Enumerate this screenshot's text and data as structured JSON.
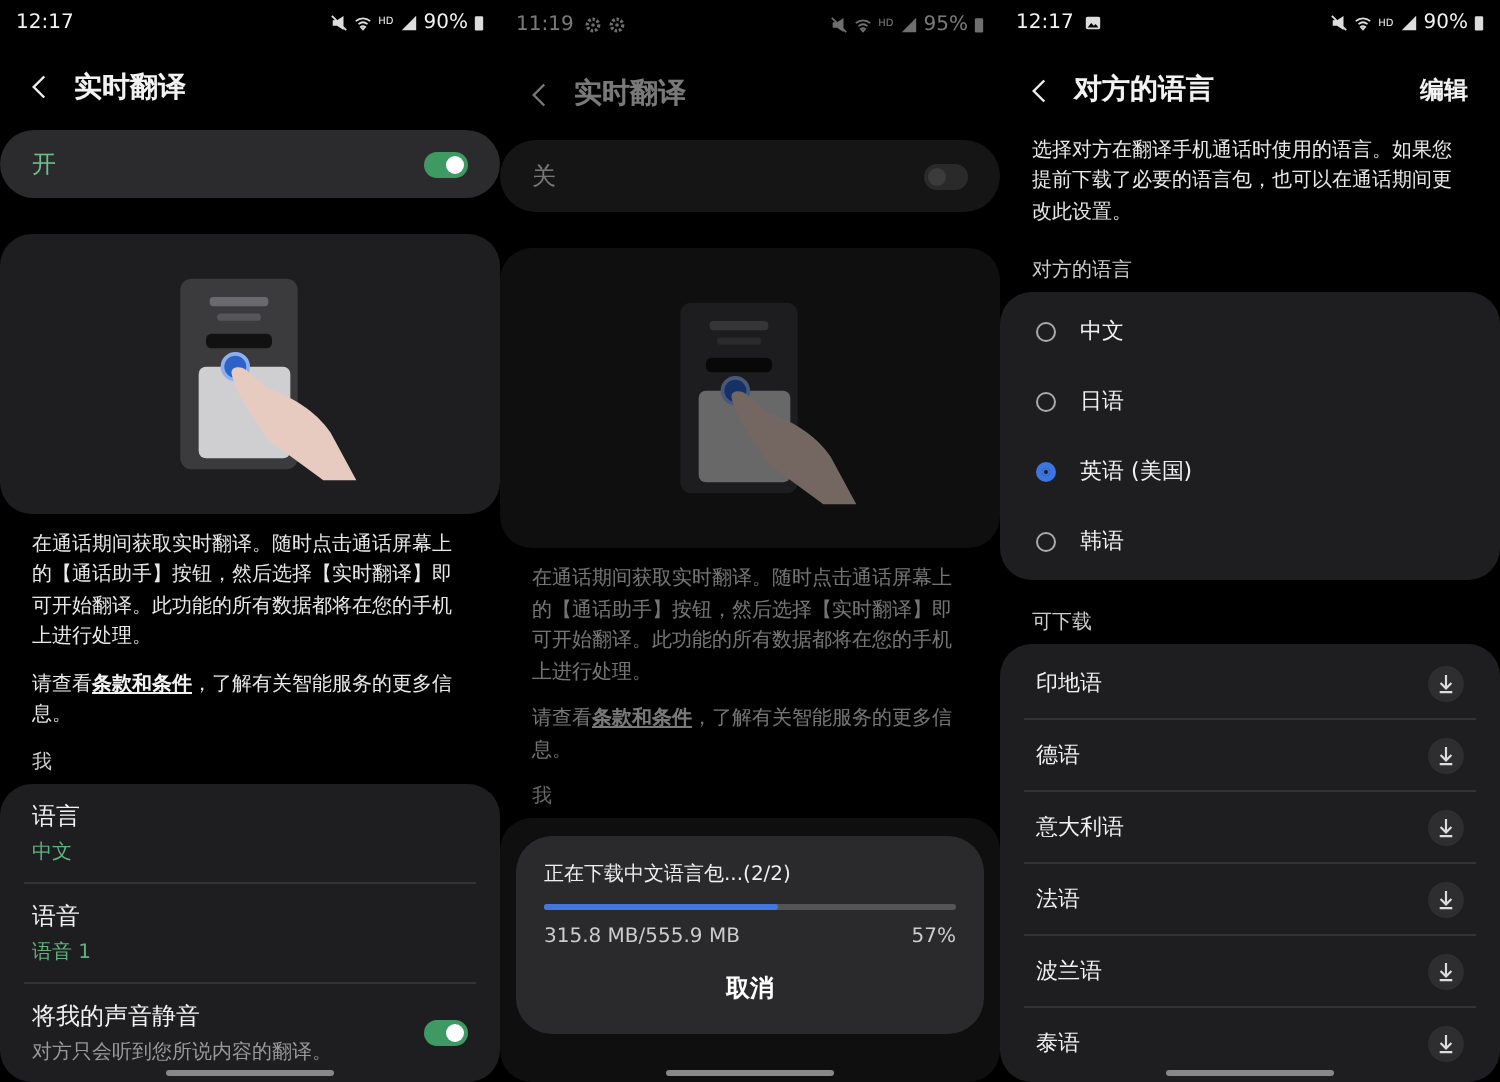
{
  "screens": [
    {
      "kind": "settings",
      "dimmed": false,
      "status_bar": {
        "time": "12:17",
        "network": "HD",
        "battery": "90%"
      },
      "title": "实时翻译",
      "master_switch": {
        "label": "开",
        "on": true
      },
      "description": "在通话期间获取实时翻译。随时点击通话屏幕上的【通话助手】按钮，然后选择【实时翻译】即可开始翻译。此功能的所有数据都将在您的手机上进行处理。",
      "terms": {
        "before": "请查看",
        "link": "条款和条件",
        "after": "，了解有关智能服务的更多信息。"
      },
      "section_label": "我",
      "settings": [
        {
          "kind": "value",
          "title": "语言",
          "value": "中文"
        },
        {
          "kind": "value",
          "title": "语音",
          "value": "语音 1"
        },
        {
          "kind": "switch",
          "title": "将我的声音静音",
          "subtitle": "对方只会听到您所说内容的翻译。",
          "on": true
        }
      ]
    },
    {
      "kind": "settings",
      "dimmed": true,
      "status_bar": {
        "time": "11:19",
        "icons": [
          {
            "kind": "gear"
          },
          {
            "kind": "gear"
          }
        ],
        "network": "HD",
        "battery": "95%"
      },
      "title": "实时翻译",
      "master_switch": {
        "label": "关",
        "on": false
      },
      "description": "在通话期间获取实时翻译。随时点击通话屏幕上的【通话助手】按钮，然后选择【实时翻译】即可开始翻译。此功能的所有数据都将在您的手机上进行处理。",
      "terms": {
        "before": "请查看",
        "link": "条款和条件",
        "after": "，了解有关智能服务的更多信息。"
      },
      "section_label": "我",
      "dialog": {
        "title": "正在下载中文语言包...(2/2)",
        "level": 0.57,
        "size": "315.8 MB/555.9 MB",
        "percent": "57%",
        "button": "取消"
      }
    },
    {
      "kind": "languages",
      "dimmed": false,
      "status_bar": {
        "time": "12:17",
        "icons": [
          {
            "kind": "image"
          }
        ],
        "network": "HD",
        "battery": "90%"
      },
      "title": "对方的语言",
      "action": "编辑",
      "description": "选择对方在翻译手机通话时使用的语言。如果您提前下载了必要的语言包，也可以在通话期间更改此设置。",
      "groups": [
        {
          "kind": "radio",
          "label": "对方的语言",
          "items": [
            {
              "label": "中文",
              "selected": false
            },
            {
              "label": "日语",
              "selected": false
            },
            {
              "label": "英语 (美国)",
              "selected": true
            },
            {
              "label": "韩语",
              "selected": false
            }
          ]
        },
        {
          "kind": "download",
          "label": "可下载",
          "items": [
            {
              "label": "印地语"
            },
            {
              "label": "德语"
            },
            {
              "label": "意大利语"
            },
            {
              "label": "法语"
            },
            {
              "label": "波兰语"
            },
            {
              "label": "泰语"
            }
          ]
        }
      ]
    }
  ]
}
